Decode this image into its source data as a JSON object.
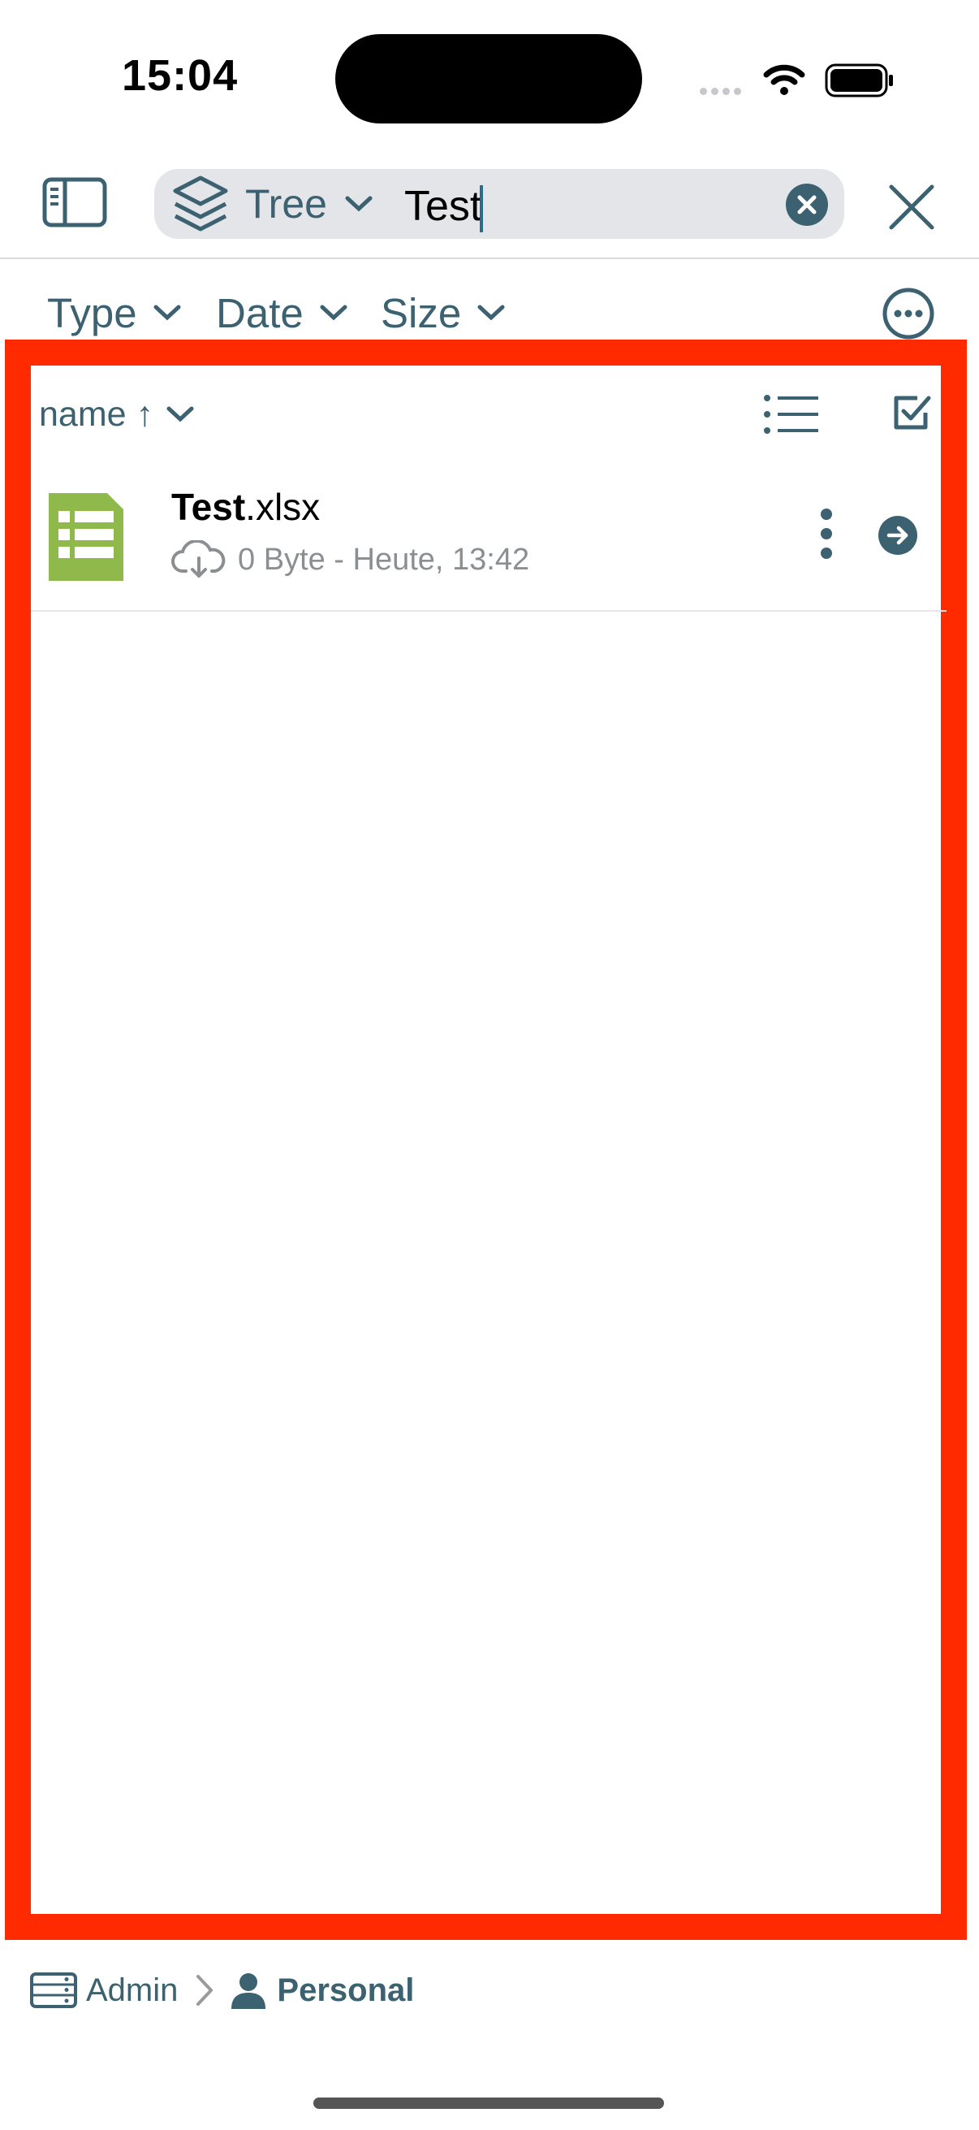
{
  "status_bar": {
    "time": "15:04"
  },
  "nav": {
    "scope_label": "Tree",
    "search_value": "Test"
  },
  "filters": [
    {
      "label": "Type"
    },
    {
      "label": "Date"
    },
    {
      "label": "Size"
    }
  ],
  "list": {
    "sort_label": "name ↑",
    "items": [
      {
        "name_bold": "Test",
        "name_ext": ".xlsx",
        "meta": "0 Byte - Heute, 13:42",
        "icon": "spreadsheet-icon"
      }
    ]
  },
  "breadcrumb": {
    "items": [
      {
        "label": "Admin",
        "icon": "server-icon"
      },
      {
        "label": "Personal",
        "icon": "person-icon"
      }
    ]
  },
  "colors": {
    "accent": "#3c6171",
    "highlight_frame": "#ff2a00",
    "spreadsheet": "#8fb94b",
    "meta_text": "#8b8f92"
  }
}
